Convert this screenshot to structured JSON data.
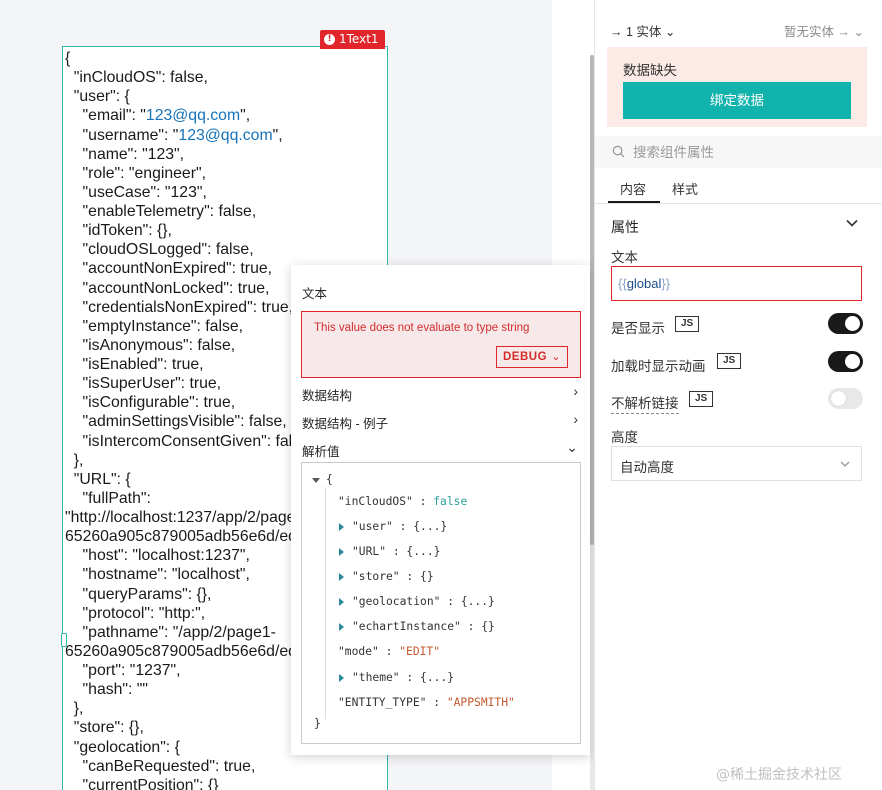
{
  "widget": {
    "badge": "1Text1",
    "lines": [
      [
        "{"
      ],
      [
        "  \"inCloudOS\": false,"
      ],
      [
        "  \"user\": {"
      ],
      [
        "    \"email\": \"",
        {
          "link": "123@qq.com"
        },
        "\","
      ],
      [
        "    \"username\": \"",
        {
          "link": "123@qq.com"
        },
        "\","
      ],
      [
        "    \"name\": \"123\","
      ],
      [
        "    \"role\": \"engineer\","
      ],
      [
        "    \"useCase\": \"123\","
      ],
      [
        "    \"enableTelemetry\": false,"
      ],
      [
        "    \"idToken\": {},"
      ],
      [
        "    \"cloudOSLogged\": false,"
      ],
      [
        "    \"accountNonExpired\": true,"
      ],
      [
        "    \"accountNonLocked\": true,"
      ],
      [
        "    \"credentialsNonExpired\": true,"
      ],
      [
        "    \"emptyInstance\": false,"
      ],
      [
        "    \"isAnonymous\": false,"
      ],
      [
        "    \"isEnabled\": true,"
      ],
      [
        "    \"isSuperUser\": true,"
      ],
      [
        "    \"isConfigurable\": true,"
      ],
      [
        "    \"adminSettingsVisible\": false,"
      ],
      [
        "    \"isIntercomConsentGiven\": false"
      ],
      [
        "  },"
      ],
      [
        "  \"URL\": {"
      ],
      [
        "    \"fullPath\":"
      ],
      [
        "\"http://localhost:1237/app/2/page1-"
      ],
      [
        "65260a905c879005adb56e6d/edit\","
      ],
      [
        "    \"host\": \"localhost:1237\","
      ],
      [
        "    \"hostname\": \"localhost\","
      ],
      [
        "    \"queryParams\": {},"
      ],
      [
        "    \"protocol\": \"http:\","
      ],
      [
        "    \"pathname\": \"/app/2/page1-"
      ],
      [
        "65260a905c879005adb56e6d/edit\","
      ],
      [
        "    \"port\": \"1237\","
      ],
      [
        "    \"hash\": \"\""
      ],
      [
        "  },"
      ],
      [
        "  \"store\": {},"
      ],
      [
        "  \"geolocation\": {"
      ],
      [
        "    \"canBeRequested\": true,"
      ],
      [
        "    \"currentPosition\": {}"
      ]
    ]
  },
  "popup": {
    "text_label": "文本",
    "error_message": "This value does not evaluate to type string",
    "debug_label": "DEBUG",
    "debug_chevron": "⌄",
    "sections": [
      {
        "label": "数据结构",
        "arrow": "›"
      },
      {
        "label": "数据结构 - 例子",
        "arrow": "›"
      },
      {
        "label": "解析值",
        "arrow": "⌄"
      }
    ],
    "tree": {
      "open": "{",
      "close": "}",
      "rows": [
        {
          "key": "\"inCloudOS\"",
          "sep": " : ",
          "val": "false",
          "kind": "bool",
          "expandable": false
        },
        {
          "key": "\"user\"",
          "sep": " : ",
          "val": "{...}",
          "kind": "obj",
          "expandable": true
        },
        {
          "key": "\"URL\"",
          "sep": " : ",
          "val": "{...}",
          "kind": "obj",
          "expandable": true
        },
        {
          "key": "\"store\"",
          "sep": " : ",
          "val": "{}",
          "kind": "empty",
          "expandable": true
        },
        {
          "key": "\"geolocation\"",
          "sep": " : ",
          "val": "{...}",
          "kind": "obj",
          "expandable": true
        },
        {
          "key": "\"echartInstance\"",
          "sep": " : ",
          "val": "{}",
          "kind": "empty",
          "expandable": true
        },
        {
          "key": "\"mode\"",
          "sep": " : ",
          "val": "\"EDIT\"",
          "kind": "str",
          "expandable": false
        },
        {
          "key": "\"theme\"",
          "sep": " : ",
          "val": "{...}",
          "kind": "obj",
          "expandable": true
        },
        {
          "key": "\"ENTITY_TYPE\"",
          "sep": " : ",
          "val": "\"APPSMITH\"",
          "kind": "str",
          "expandable": false
        }
      ]
    }
  },
  "panel": {
    "entity_left": "→ 1 实体 ⌄",
    "entity_right": "暂无实体 → ⌄",
    "missing_text": "数据缺失",
    "bind_button": "绑定数据",
    "search_placeholder": "搜索组件属性",
    "tabs": [
      "内容",
      "样式"
    ],
    "section_title": "属性",
    "text_label": "文本",
    "text_value_open": "{{",
    "text_value_mid": "global",
    "text_value_close": "}}",
    "props": [
      {
        "label": "是否显示",
        "js": "JS",
        "toggle": true
      },
      {
        "label": "加载时显示动画",
        "js": "JS",
        "toggle": true
      },
      {
        "label": "不解析链接",
        "js": "JS",
        "toggle": false
      }
    ],
    "height_label": "高度",
    "height_value": "自动高度"
  },
  "watermark": "@稀土掘金技术社区",
  "colors": {
    "accent": "#12b3ac",
    "error": "#e0262b",
    "widget_border": "#31b5ad",
    "link": "#1673b8",
    "bool": "#2aa198",
    "string": "#c45a2f"
  }
}
